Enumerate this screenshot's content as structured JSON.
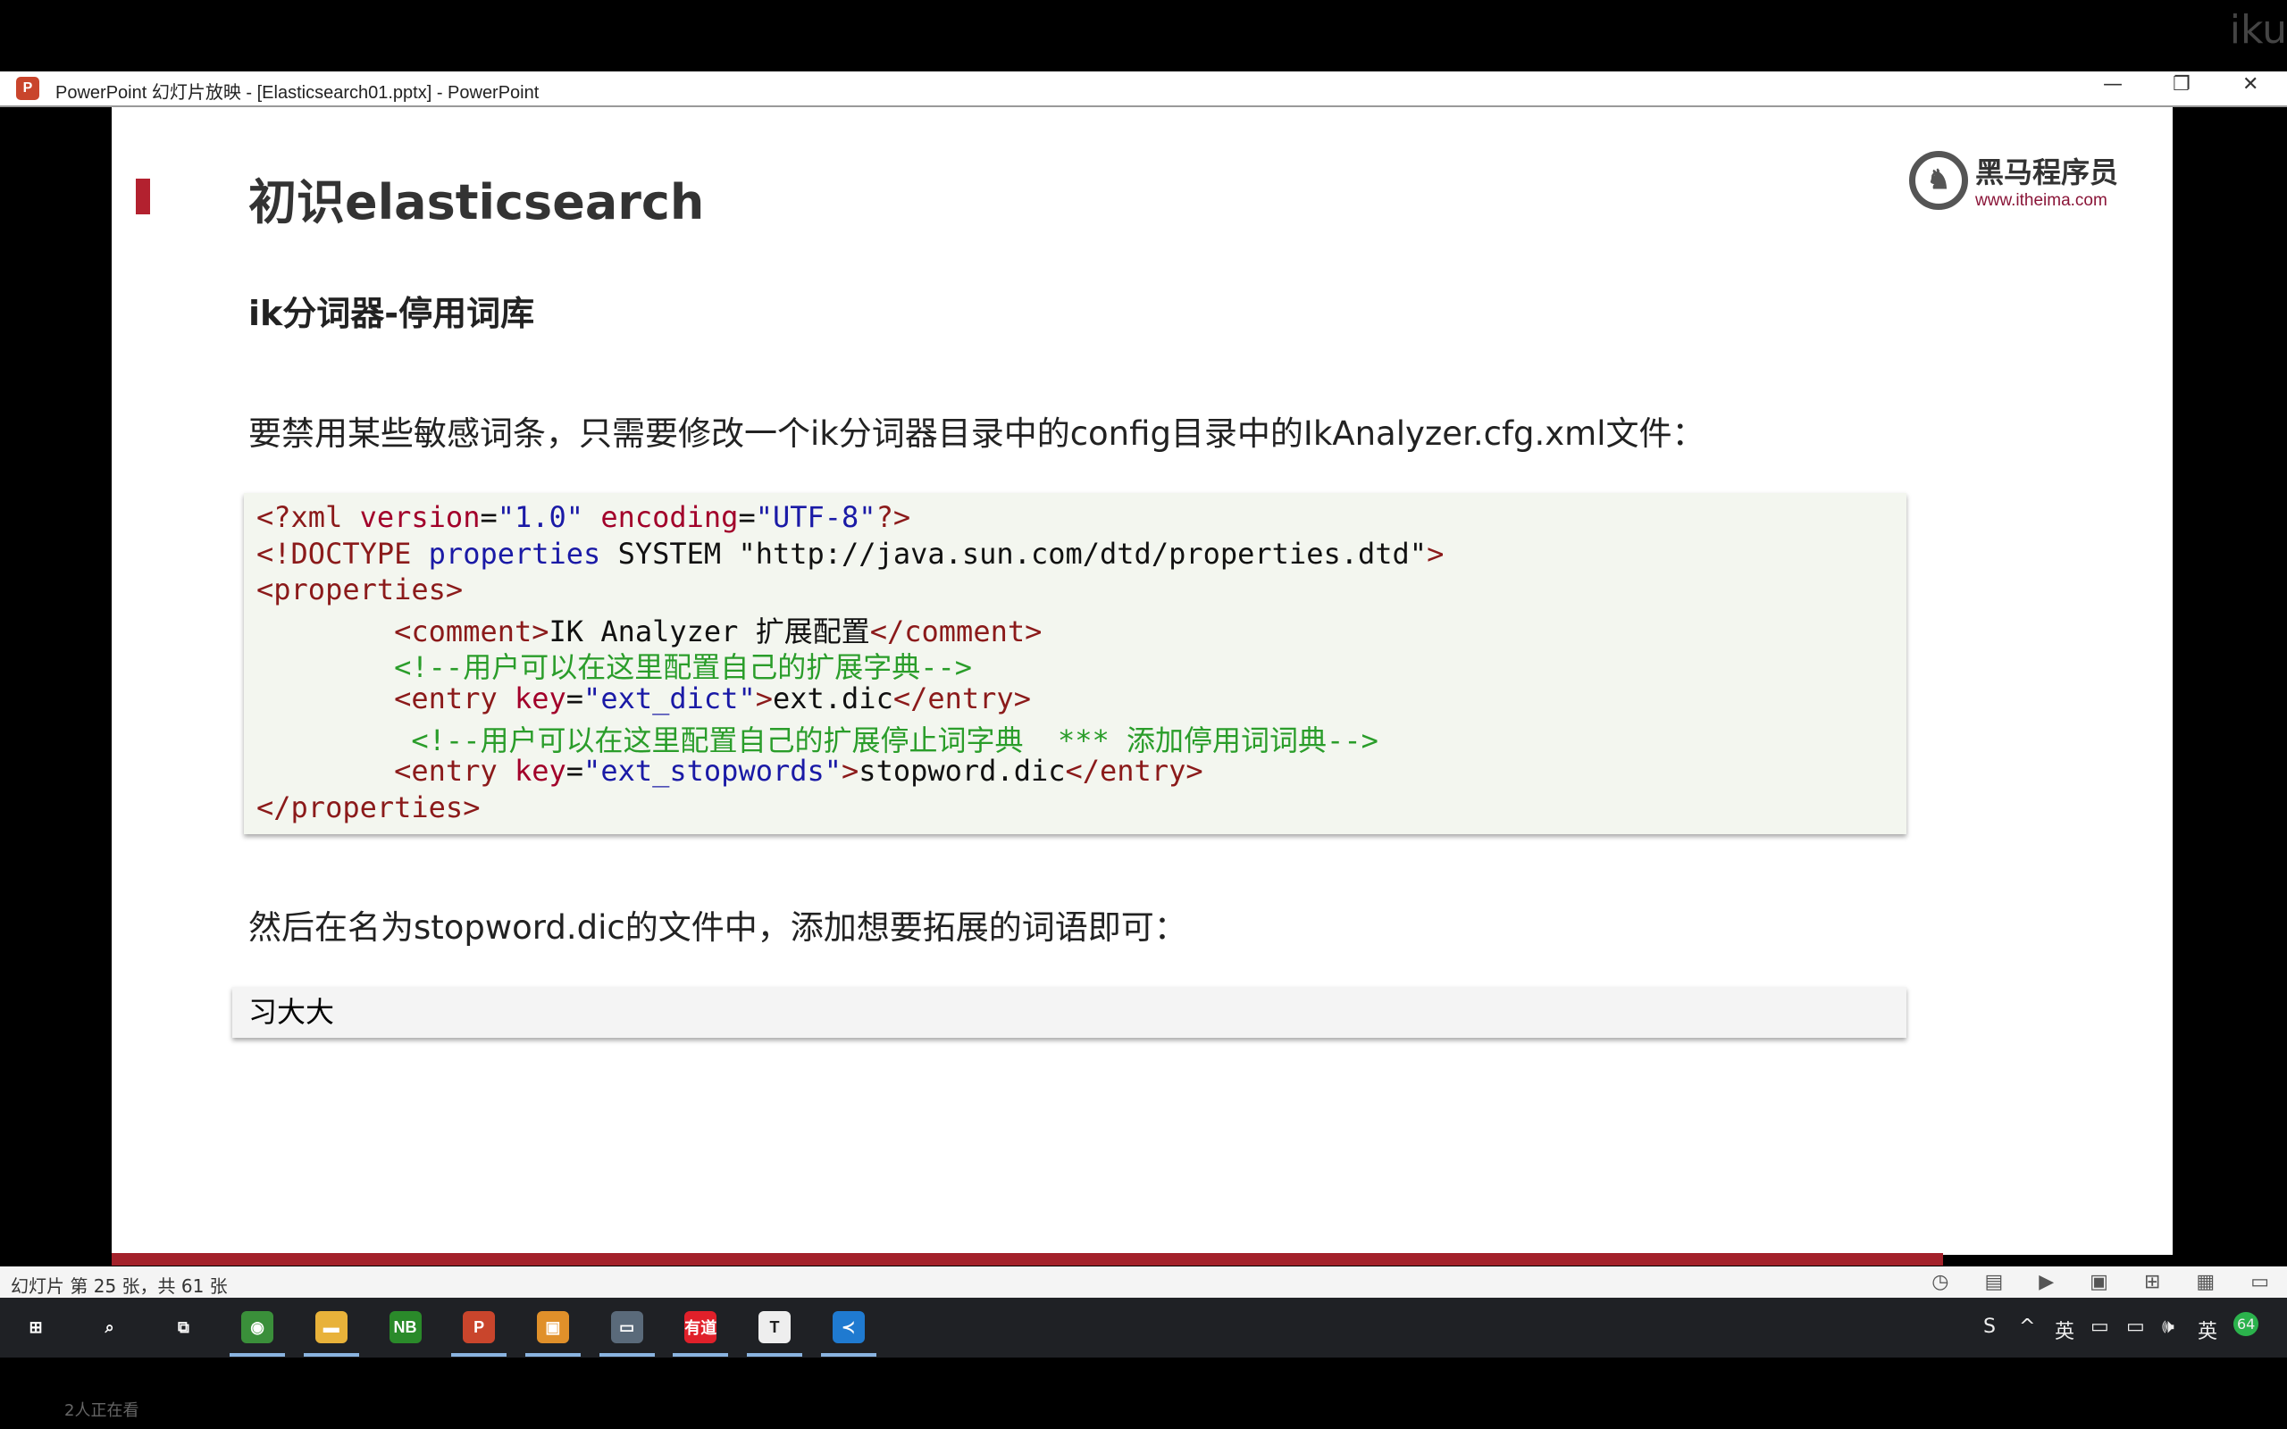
{
  "window": {
    "title": "PowerPoint 幻灯片放映 - [Elasticsearch01.pptx] - PowerPoint",
    "app_icon": "powerpoint-icon",
    "minimize": "—",
    "restore": "❐",
    "close": "✕"
  },
  "watermark": "iku",
  "slide": {
    "title": "初识elasticsearch",
    "logo": {
      "name": "黑马程序员",
      "url": "www.itheima.com"
    },
    "subtitle": "ik分词器-停用词库",
    "para1": "要禁用某些敏感词条，只需要修改一个ik分词器目录中的config目录中的IkAnalyzer.cfg.xml文件：",
    "code_lines": [
      [
        [
          "<?xml ",
          "t"
        ],
        [
          "version",
          "a"
        ],
        [
          "=",
          "x"
        ],
        [
          "\"1.0\" ",
          "s"
        ],
        [
          "encoding",
          "a"
        ],
        [
          "=",
          "x"
        ],
        [
          "\"UTF-8\"",
          "s"
        ],
        [
          "?>",
          "t"
        ]
      ],
      [
        [
          "<!DOCTYPE ",
          "t"
        ],
        [
          "properties ",
          "s"
        ],
        [
          "SYSTEM ",
          "x"
        ],
        [
          "\"http://java.sun.com/dtd/properties.dtd\"",
          "x"
        ],
        [
          ">",
          "t"
        ]
      ],
      [
        [
          "<properties>",
          "t"
        ]
      ],
      [
        [
          "        <comment>",
          "t"
        ],
        [
          "IK Analyzer 扩展配置",
          "x"
        ],
        [
          "</comment>",
          "t"
        ]
      ],
      [
        [
          "        <!--用户可以在这里配置自己的扩展字典-->",
          "c"
        ]
      ],
      [
        [
          "        <entry ",
          "t"
        ],
        [
          "key",
          "a"
        ],
        [
          "=",
          "x"
        ],
        [
          "\"ext_dict\"",
          "s"
        ],
        [
          ">",
          "t"
        ],
        [
          "ext.dic",
          "x"
        ],
        [
          "</entry>",
          "t"
        ]
      ],
      [
        [
          "         <!--用户可以在这里配置自己的扩展停止词字典  *** 添加停用词词典-->",
          "c"
        ]
      ],
      [
        [
          "        <entry ",
          "t"
        ],
        [
          "key",
          "a"
        ],
        [
          "=",
          "x"
        ],
        [
          "\"ext_stopwords\"",
          "s"
        ],
        [
          ">",
          "t"
        ],
        [
          "stopword.dic",
          "x"
        ],
        [
          "</entry>",
          "t"
        ]
      ],
      [
        [
          "</properties>",
          "t"
        ]
      ]
    ],
    "para2": "然后在名为stopword.dic的文件中，添加想要拓展的词语即可：",
    "stopword_content": "习大大",
    "accent_color": "#a3212a"
  },
  "status_bar": {
    "slide_info": "幻灯片 第 25 张，共 61 张",
    "view_icons": [
      "◷",
      "▤",
      "▶",
      "▣",
      "⊞",
      "▦",
      "▭"
    ]
  },
  "taskbar": {
    "items": [
      {
        "name": "start-button",
        "label": "⊞",
        "bg": "transparent",
        "running": false
      },
      {
        "name": "search-button",
        "label": "⌕",
        "bg": "transparent",
        "running": false
      },
      {
        "name": "task-view-button",
        "label": "⧉",
        "bg": "transparent",
        "running": false
      },
      {
        "name": "chrome",
        "label": "◉",
        "bg": "#3a8f3a",
        "running": true
      },
      {
        "name": "file-explorer",
        "label": "▬",
        "bg": "#e8b23a",
        "running": true
      },
      {
        "name": "notepad-plus",
        "label": "NB",
        "bg": "#2a8a2a",
        "running": false
      },
      {
        "name": "powerpoint",
        "label": "P",
        "bg": "#c9452c",
        "running": true
      },
      {
        "name": "vmware",
        "label": "▣",
        "bg": "#e0902a",
        "running": true
      },
      {
        "name": "remote-desktop",
        "label": "▭",
        "bg": "#5a6a7a",
        "running": true
      },
      {
        "name": "youdao",
        "label": "有道",
        "bg": "#e0202a",
        "running": true
      },
      {
        "name": "typora",
        "label": "T",
        "bg": "#eeeeee",
        "running": true
      },
      {
        "name": "vscode",
        "label": "≺",
        "bg": "#1f7ad0",
        "running": true
      }
    ],
    "tray": [
      "S",
      "^",
      "英",
      "▭",
      "▭",
      "🕪",
      "英",
      "64"
    ]
  },
  "viewers": "2人正在看"
}
